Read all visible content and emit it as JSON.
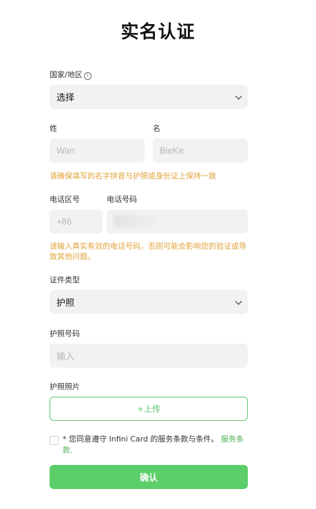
{
  "page": {
    "title": "实名认证"
  },
  "country": {
    "label": "国家/地区",
    "info_icon": "ⓘ",
    "value": "选择"
  },
  "name": {
    "last_label": "姓",
    "last_placeholder": "Wan",
    "first_label": "名",
    "first_placeholder": "BieKe",
    "hint": "请确保填写的名字拼音与护照或身份证上保持一致"
  },
  "phone": {
    "code_label": "电话区号",
    "code_placeholder": "+86",
    "number_label": "电话号码",
    "hint": "请输入真实有效的电话号码，否则可能会影响您的验证或导致其他问题。"
  },
  "document": {
    "type_label": "证件类型",
    "type_value": "护照",
    "number_label": "护照号码",
    "number_placeholder": "输入",
    "photo_label": "护照照片",
    "upload_label": "+上传"
  },
  "terms": {
    "text": "* 您同意遵守 Infini Card 的服务条款与条件。",
    "link": "服务条款."
  },
  "actions": {
    "confirm_label": "确认"
  },
  "colors": {
    "accent": "#5ccf6a",
    "warning": "#e0a33a",
    "field_bg": "#f2f2f2"
  }
}
